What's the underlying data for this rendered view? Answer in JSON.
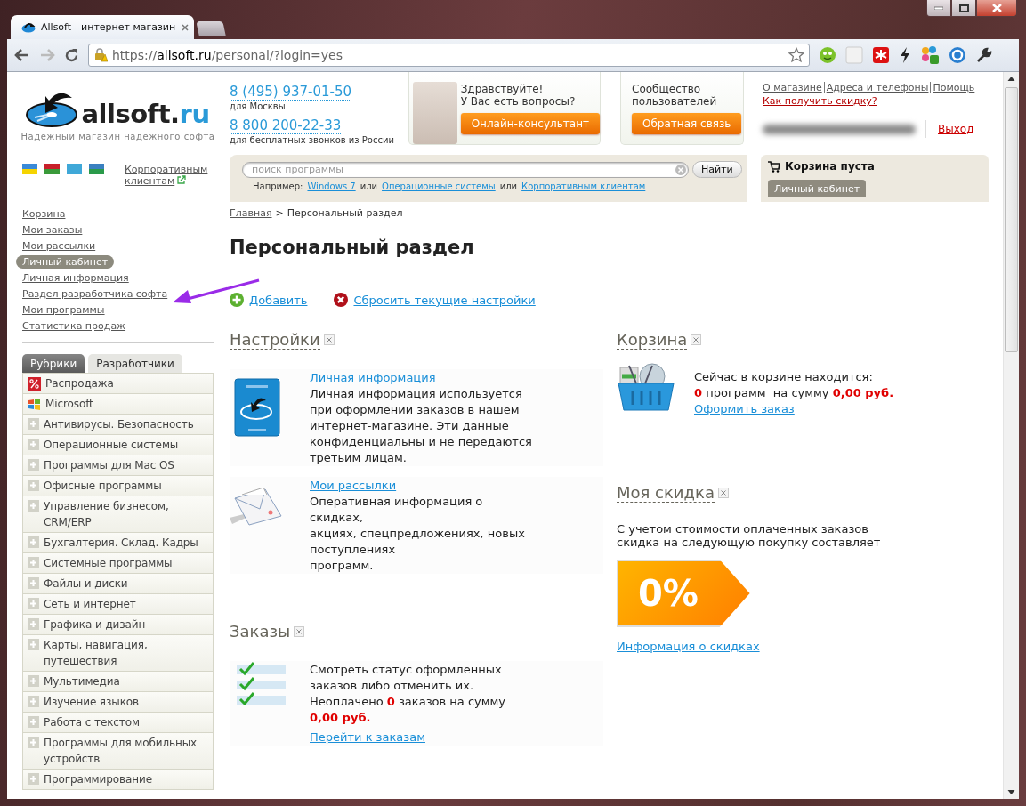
{
  "browser": {
    "tab_title": "Allsoft - интернет магазин",
    "url": "https://**allsoft.ru**/personal/?login=yes"
  },
  "header": {
    "logo": "allsoft.**ru**",
    "tagline": "Надежный магазин надежного софта",
    "phones": [
      {
        "number": "8 (495) 937-01-50",
        "note": "для Москвы"
      },
      {
        "number": "8 800 200-22-33",
        "note": "для бесплатных звонков из России"
      }
    ],
    "consultant": {
      "lines": [
        "Здравствуйте!",
        "У Вас есть вопросы?"
      ],
      "button": "Онлайн-консультант"
    },
    "community": {
      "title": "Сообщество пользователей",
      "button": "Обратная связь"
    },
    "top_links": [
      "О магазине",
      "Адреса и телефоны",
      "Помощь"
    ],
    "discount_link": "Как получить скидку?",
    "logout": "Выход",
    "corporate_link": "Корпоративным клиентам",
    "search": {
      "placeholder": "поиск программы",
      "button": "Найти",
      "hint": [
        {
          "kind": "text",
          "text": "Например:"
        },
        {
          "kind": "link",
          "text": "Windows 7"
        },
        {
          "kind": "text",
          "text": "или"
        },
        {
          "kind": "link",
          "text": "Операционные системы"
        },
        {
          "kind": "text",
          "text": "или"
        },
        {
          "kind": "link",
          "text": "Корпоративным клиентам"
        }
      ]
    },
    "cart": {
      "title": "Корзина пуста",
      "tab": "Личный кабинет"
    }
  },
  "account_nav": [
    {
      "kind": "link",
      "label": "Корзина",
      "marked": false
    },
    {
      "kind": "link",
      "label": "Мои заказы",
      "marked": false
    },
    {
      "kind": "link",
      "label": "Мои рассылки",
      "marked": false
    },
    {
      "kind": "heading",
      "label": "Личный кабинет",
      "marked": false
    },
    {
      "kind": "link",
      "label": "Личная информация",
      "marked": false
    },
    {
      "kind": "link",
      "label": "Раздел разработчика софта",
      "marked": true
    },
    {
      "kind": "link",
      "label": "Мои программы",
      "marked": false
    },
    {
      "kind": "link",
      "label": "Статистика продаж",
      "marked": false
    }
  ],
  "category_tabs": [
    {
      "label": "Рубрики",
      "selected": true
    },
    {
      "label": "Разработчики",
      "selected": false
    }
  ],
  "categories": [
    {
      "kind": "sale",
      "label": "Распродажа"
    },
    {
      "kind": "windows",
      "label": "Microsoft"
    },
    {
      "kind": "group",
      "label": "Антивирусы. Безопасность"
    },
    {
      "kind": "group",
      "label": "Операционные системы"
    },
    {
      "kind": "group",
      "label": "Программы для Mac OS"
    },
    {
      "kind": "group",
      "label": "Офисные программы"
    },
    {
      "kind": "group",
      "label": "Управление бизнесом, CRM/ERP"
    },
    {
      "kind": "group",
      "label": "Бухгалтерия. Склад. Кадры"
    },
    {
      "kind": "group",
      "label": "Системные программы"
    },
    {
      "kind": "group",
      "label": "Файлы и диски"
    },
    {
      "kind": "group",
      "label": "Сеть и интернет"
    },
    {
      "kind": "group",
      "label": "Графика и дизайн"
    },
    {
      "kind": "group",
      "label": "Карты, навигация, путешествия"
    },
    {
      "kind": "group",
      "label": "Мультимедиа"
    },
    {
      "kind": "group",
      "label": "Изучение языков"
    },
    {
      "kind": "group",
      "label": "Работа с текстом"
    },
    {
      "kind": "group",
      "label": "Программы для мобильных устройств"
    },
    {
      "kind": "group",
      "label": "Программирование"
    }
  ],
  "breadcrumb": {
    "home": "Главная",
    "separator": ">",
    "current": "Персональный раздел"
  },
  "page_title": "Персональный раздел",
  "actions": [
    {
      "kind": "add",
      "label": "Добавить"
    },
    {
      "kind": "reset",
      "label": "Сбросить текущие настройки"
    }
  ],
  "columns": [
    [
      {
        "kind": "settings",
        "title": "Настройки",
        "items": [
          {
            "kind": "passport",
            "link": "Личная информация",
            "lines": [
              "Личная информация используется при оформлении заказов в нашем интернет-магазине. Эти данные конфиденциальны и не передаются третьим лицам."
            ]
          },
          {
            "kind": "envelope",
            "link": "Мои рассылки",
            "lines": [
              "Оперативная информация о скидках,",
              "акциях, спецпредложениях, новых поступлениях",
              "программ."
            ]
          }
        ]
      },
      {
        "kind": "orders",
        "title": "Заказы",
        "lines": [
          "Смотреть статус оформленных заказов либо отменить их.",
          "Неоплачено **0** заказов на сумму **0,00 руб.**"
        ],
        "link": "Перейти к заказам"
      }
    ],
    [
      {
        "kind": "cart",
        "title": "Корзина",
        "lines": [
          "Сейчас в корзине находится:",
          "**0** программ  на сумму **0,00 руб.**"
        ],
        "link": "Оформить заказ"
      },
      {
        "kind": "discount",
        "title": "Моя скидка",
        "lines": [
          "С учетом стоимости оплаченных заказов",
          "скидка на следующую покупку составляет"
        ],
        "badge": "0%",
        "link": "Информация о скидках"
      }
    ]
  ]
}
